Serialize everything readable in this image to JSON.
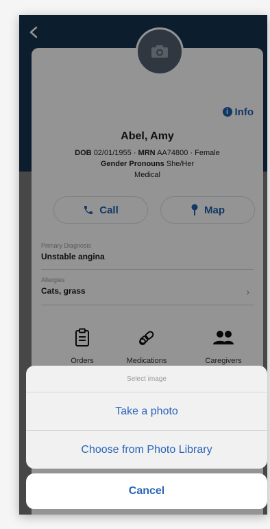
{
  "header": {
    "back_icon": "chevron-left-icon",
    "background": "#16324f"
  },
  "avatar": {
    "icon": "camera-icon"
  },
  "info": {
    "label": "Info",
    "icon": "info-circle-icon"
  },
  "patient": {
    "name": "Abel, Amy",
    "dob_label": "DOB",
    "dob_value": "02/01/1955",
    "separator": "·",
    "mrn_label": "MRN",
    "mrn_value": "AA74800",
    "sex": "Female",
    "pronouns_label": "Gender Pronouns",
    "pronouns_value": "She/Her",
    "category": "Medical"
  },
  "actions": {
    "call": {
      "label": "Call",
      "icon": "phone-icon"
    },
    "map": {
      "label": "Map",
      "icon": "map-pin-icon"
    }
  },
  "fields": {
    "primary_diagnosis": {
      "label": "Primary Diagnosis",
      "value": "Unstable angina"
    },
    "allergies": {
      "label": "Allergies",
      "value": "Cats, grass",
      "chevron_icon": "chevron-right-icon"
    }
  },
  "tiles": [
    {
      "label": "Orders",
      "icon": "clipboard-icon"
    },
    {
      "label": "Medications",
      "icon": "pills-icon"
    },
    {
      "label": "Caregivers",
      "icon": "people-icon"
    },
    {
      "label": "",
      "icon": "stethoscope-icon"
    },
    {
      "label": "",
      "icon": "building-icon"
    },
    {
      "label": "",
      "icon": "phone-icon"
    }
  ],
  "sheet": {
    "title": "Select image",
    "options": [
      "Take a photo",
      "Choose from Photo Library"
    ],
    "cancel": "Cancel"
  },
  "colors": {
    "accent": "#1f5fae",
    "sheet_text": "#2a64b8",
    "dim_overlay": "rgba(0,0,0,0.42)"
  }
}
